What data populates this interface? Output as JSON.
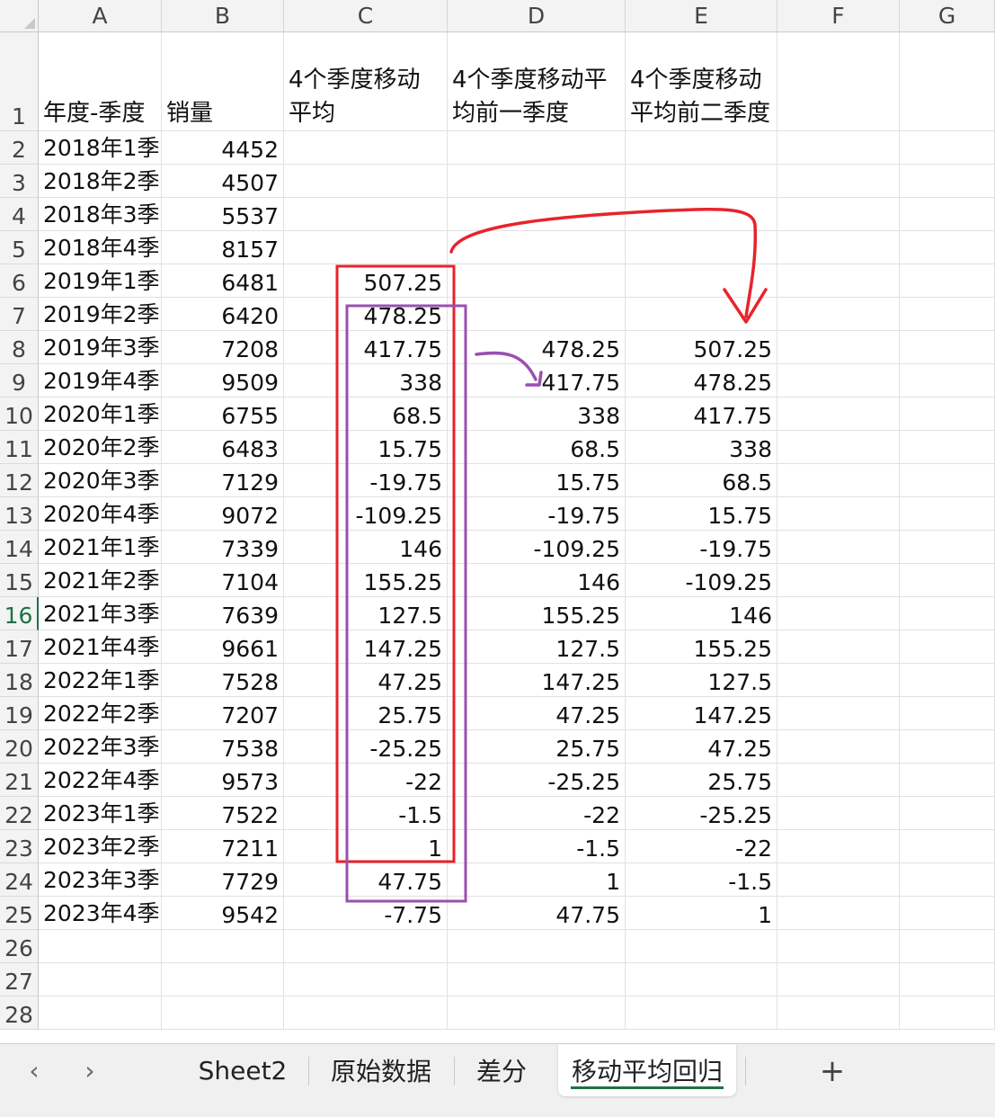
{
  "columns": [
    "A",
    "B",
    "C",
    "D",
    "E",
    "F",
    "G"
  ],
  "header_row": {
    "A": "年度-季度",
    "B": "销量",
    "C": "4个季度移动平均",
    "D": "4个季度移动平均前一季度",
    "E": "4个季度移动平均前二季度"
  },
  "rows": [
    {
      "A": "2018年1季",
      "B": "4452",
      "C": "",
      "D": "",
      "E": ""
    },
    {
      "A": "2018年2季",
      "B": "4507",
      "C": "",
      "D": "",
      "E": ""
    },
    {
      "A": "2018年3季",
      "B": "5537",
      "C": "",
      "D": "",
      "E": ""
    },
    {
      "A": "2018年4季",
      "B": "8157",
      "C": "",
      "D": "",
      "E": ""
    },
    {
      "A": "2019年1季",
      "B": "6481",
      "C": "507.25",
      "D": "",
      "E": ""
    },
    {
      "A": "2019年2季",
      "B": "6420",
      "C": "478.25",
      "D": "",
      "E": ""
    },
    {
      "A": "2019年3季",
      "B": "7208",
      "C": "417.75",
      "D": "478.25",
      "E": "507.25"
    },
    {
      "A": "2019年4季",
      "B": "9509",
      "C": "338",
      "D": "417.75",
      "E": "478.25"
    },
    {
      "A": "2020年1季",
      "B": "6755",
      "C": "68.5",
      "D": "338",
      "E": "417.75"
    },
    {
      "A": "2020年2季",
      "B": "6483",
      "C": "15.75",
      "D": "68.5",
      "E": "338"
    },
    {
      "A": "2020年3季",
      "B": "7129",
      "C": "-19.75",
      "D": "15.75",
      "E": "68.5"
    },
    {
      "A": "2020年4季",
      "B": "9072",
      "C": "-109.25",
      "D": "-19.75",
      "E": "15.75"
    },
    {
      "A": "2021年1季",
      "B": "7339",
      "C": "146",
      "D": "-109.25",
      "E": "-19.75"
    },
    {
      "A": "2021年2季",
      "B": "7104",
      "C": "155.25",
      "D": "146",
      "E": "-109.25"
    },
    {
      "A": "2021年3季",
      "B": "7639",
      "C": "127.5",
      "D": "155.25",
      "E": "146"
    },
    {
      "A": "2021年4季",
      "B": "9661",
      "C": "147.25",
      "D": "127.5",
      "E": "155.25"
    },
    {
      "A": "2022年1季",
      "B": "7528",
      "C": "47.25",
      "D": "147.25",
      "E": "127.5"
    },
    {
      "A": "2022年2季",
      "B": "7207",
      "C": "25.75",
      "D": "47.25",
      "E": "147.25"
    },
    {
      "A": "2022年3季",
      "B": "7538",
      "C": "-25.25",
      "D": "25.75",
      "E": "47.25"
    },
    {
      "A": "2022年4季",
      "B": "9573",
      "C": "-22",
      "D": "-25.25",
      "E": "25.75"
    },
    {
      "A": "2023年1季",
      "B": "7522",
      "C": "-1.5",
      "D": "-22",
      "E": "-25.25"
    },
    {
      "A": "2023年2季",
      "B": "7211",
      "C": "1",
      "D": "-1.5",
      "E": "-22"
    },
    {
      "A": "2023年3季",
      "B": "7729",
      "C": "47.75",
      "D": "1",
      "E": "-1.5"
    },
    {
      "A": "2023年4季",
      "B": "9542",
      "C": "-7.75",
      "D": "47.75",
      "E": "1"
    }
  ],
  "row_numbers": [
    "1",
    "2",
    "3",
    "4",
    "5",
    "6",
    "7",
    "8",
    "9",
    "10",
    "11",
    "12",
    "13",
    "14",
    "15",
    "16",
    "17",
    "18",
    "19",
    "20",
    "21",
    "22",
    "23",
    "24",
    "25",
    "26",
    "27",
    "28"
  ],
  "active_row": "16",
  "sheet_tabs": [
    {
      "label": "Sheet2",
      "active": false
    },
    {
      "label": "原始数据",
      "active": false
    },
    {
      "label": "差分",
      "active": false
    },
    {
      "label": "移动平均回归",
      "active": true
    }
  ],
  "add_sheet_label": "+",
  "annotation_colors": {
    "red": "#e8232b",
    "purple": "#9a4fb0"
  },
  "accent_color": "#1e7145"
}
